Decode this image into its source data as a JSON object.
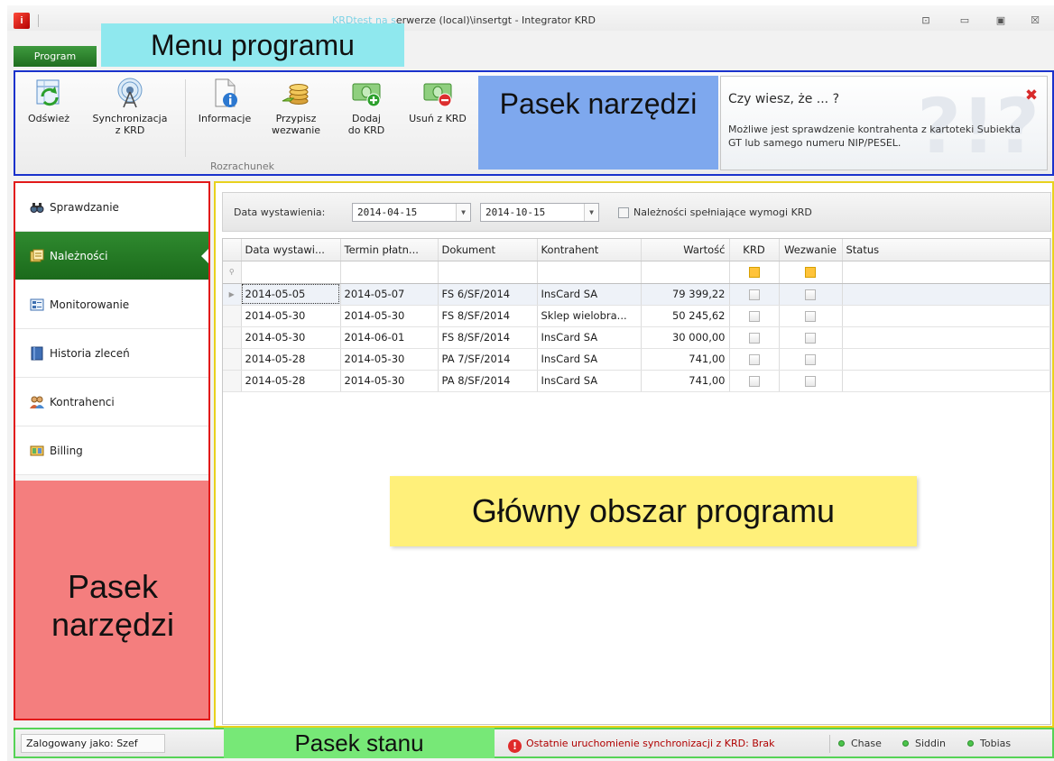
{
  "window": {
    "title_faint": "KRDtest na s",
    "title": "erwerze (local)\\insertgt - Integrator KRD",
    "controls": {
      "restore": "⊡",
      "minimize": "▭",
      "maximize": "▣",
      "close": "☒"
    }
  },
  "menu": {
    "program_tab": "Program"
  },
  "ribbon": {
    "buttons": [
      {
        "label": "Odśwież",
        "icon": "refresh-icon"
      },
      {
        "label": "Synchronizacja\nz KRD",
        "icon": "sync-antenna-icon"
      },
      {
        "label": "Informacje",
        "icon": "info-document-icon"
      },
      {
        "label": "Przypisz\nwezwanie",
        "icon": "assign-coins-icon"
      },
      {
        "label": "Dodaj\ndo KRD",
        "icon": "add-money-icon"
      },
      {
        "label": "Usuń z KRD",
        "icon": "remove-money-icon"
      }
    ],
    "group_label": "Rozrachunek"
  },
  "tip": {
    "title": "Czy wiesz, że ... ?",
    "text": "Możliwe jest sprawdzenie kontrahenta z kartoteki Subiekta GT lub samego numeru NIP/PESEL.",
    "background_glyph": "?!?"
  },
  "nav": {
    "items": [
      {
        "label": "Sprawdzanie",
        "icon": "binoculars-icon",
        "active": false
      },
      {
        "label": "Należności",
        "icon": "receivables-icon",
        "active": true
      },
      {
        "label": "Monitorowanie",
        "icon": "monitor-list-icon",
        "active": false
      },
      {
        "label": "Historia zleceń",
        "icon": "book-icon",
        "active": false
      },
      {
        "label": "Kontrahenci",
        "icon": "contacts-icon",
        "active": false
      },
      {
        "label": "Billing",
        "icon": "billing-icon",
        "active": false
      }
    ]
  },
  "filters": {
    "label": "Data wystawienia:",
    "date_from": "2014-04-15",
    "date_to": "2014-10-15",
    "requirement_label": "Należności spełniające wymogi KRD",
    "requirement_checked": false
  },
  "grid": {
    "columns": [
      "Data wystawi...",
      "Termin płatn...",
      "Dokument",
      "Kontrahent",
      "Wartość",
      "KRD",
      "Wezwanie",
      "Status"
    ],
    "rows": [
      {
        "data_wystawienia": "2014-05-05",
        "termin_platnosci": "2014-05-07",
        "dokument": "FS 6/SF/2014",
        "kontrahent": "InsCard SA",
        "wartosc": "79 399,22",
        "krd": false,
        "wezwanie": false,
        "status": ""
      },
      {
        "data_wystawienia": "2014-05-30",
        "termin_platnosci": "2014-05-30",
        "dokument": "FS 8/SF/2014",
        "kontrahent": "Sklep wielobra...",
        "wartosc": "50 245,62",
        "krd": false,
        "wezwanie": false,
        "status": ""
      },
      {
        "data_wystawienia": "2014-05-30",
        "termin_platnosci": "2014-06-01",
        "dokument": "FS 8/SF/2014",
        "kontrahent": "InsCard SA",
        "wartosc": "30 000,00",
        "krd": false,
        "wezwanie": false,
        "status": ""
      },
      {
        "data_wystawienia": "2014-05-28",
        "termin_platnosci": "2014-05-30",
        "dokument": "PA 7/SF/2014",
        "kontrahent": "InsCard SA",
        "wartosc": "741,00",
        "krd": false,
        "wezwanie": false,
        "status": ""
      },
      {
        "data_wystawienia": "2014-05-28",
        "termin_platnosci": "2014-05-30",
        "dokument": "PA 8/SF/2014",
        "kontrahent": "InsCard SA",
        "wartosc": "741,00",
        "krd": false,
        "wezwanie": false,
        "status": ""
      }
    ]
  },
  "status": {
    "logged_in": "Zalogowany jako: Szef",
    "sync": "Ostatnie uruchomienie synchronizacji z KRD: Brak",
    "sync_icon_glyph": "!",
    "users": [
      "Chase",
      "Siddin",
      "Tobias"
    ]
  },
  "annotations": {
    "menu": "Menu programu",
    "toolbar": "Pasek narzędzi",
    "main": "Główny obszar programu",
    "sidebar": "Pasek narzędzi",
    "status": "Pasek stanu"
  },
  "colors": {
    "accent_green": "#1f6e1f",
    "menu_highlight": "#8fe8ee",
    "toolbar_highlight": "#7ea8ee",
    "main_highlight": "#fff07a",
    "sidebar_highlight": "#f47e7e",
    "status_highlight": "#77e877"
  }
}
